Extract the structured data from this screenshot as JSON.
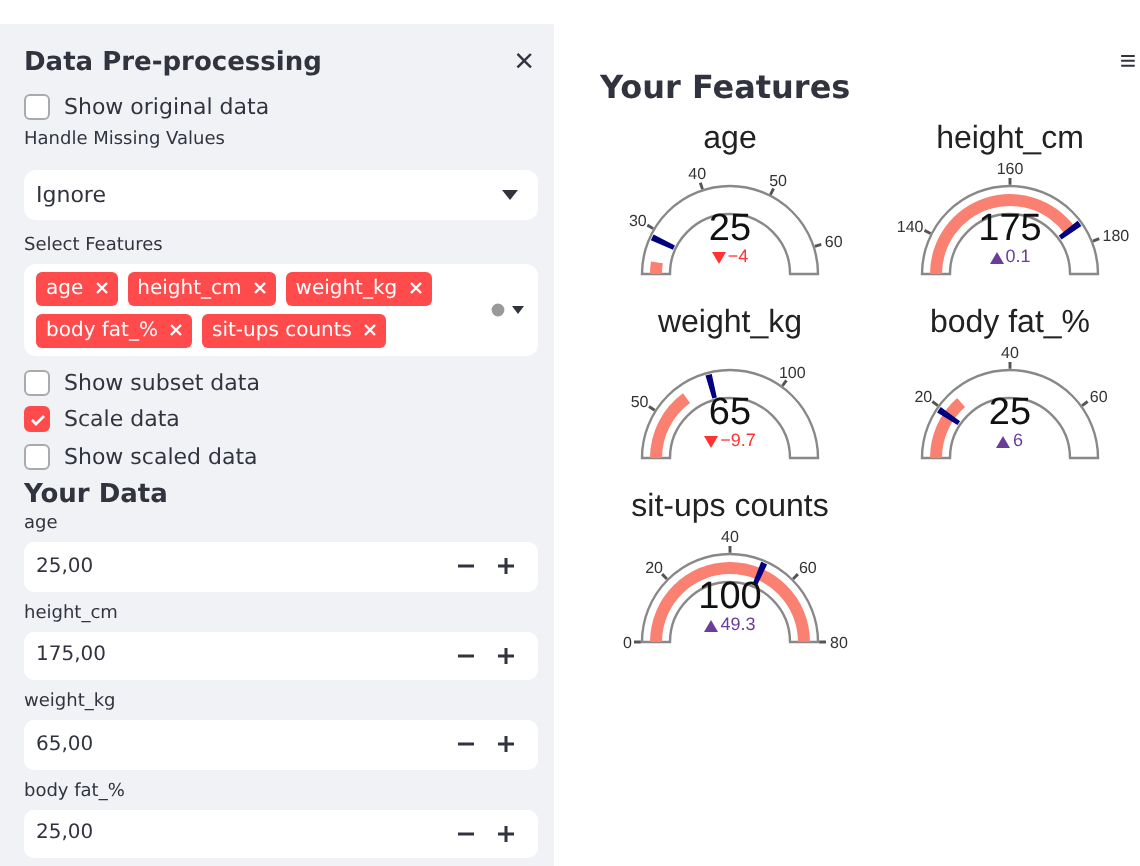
{
  "sidebar": {
    "title": "Data Pre-processing",
    "close": "×",
    "options_top": [
      {
        "label": "Show original data",
        "checked": false
      }
    ],
    "missing": {
      "label": "Handle Missing Values",
      "value": "Ignore"
    },
    "features": {
      "label": "Select Features",
      "tags": [
        "age",
        "height_cm",
        "weight_kg",
        "body fat_%",
        "sit-ups counts"
      ]
    },
    "options": [
      {
        "label": "Show subset data",
        "checked": false
      },
      {
        "label": "Scale data",
        "checked": true
      },
      {
        "label": "Show scaled data",
        "checked": false
      }
    ],
    "data_title": "Your Data",
    "inputs": [
      {
        "label": "age",
        "value": "25,00"
      },
      {
        "label": "height_cm",
        "value": "175,00"
      },
      {
        "label": "weight_kg",
        "value": "65,00"
      },
      {
        "label": "body fat_%",
        "value": "25,00"
      }
    ]
  },
  "main": {
    "menu": "≡",
    "title": "Your Features",
    "gauges": [
      {
        "title": "age",
        "value": "25",
        "delta": "−4",
        "increasing": false,
        "level": 0.05,
        "marker": {
          "level": 0.14
        },
        "ticks": [
          {
            "label": "30",
            "level": 0.17
          },
          {
            "label": "40",
            "level": 0.4
          },
          {
            "label": "50",
            "level": 0.65
          },
          {
            "label": "60",
            "level": 0.9
          }
        ]
      },
      {
        "title": "height_cm",
        "value": "175",
        "delta": "0.1",
        "increasing": true,
        "level": 0.8,
        "marker": {
          "level": 0.8
        },
        "ticks": [
          {
            "label": "140",
            "level": 0.15
          },
          {
            "label": "160",
            "level": 0.5
          },
          {
            "label": "180",
            "level": 0.88
          }
        ]
      },
      {
        "title": "weight_kg",
        "value": "65",
        "delta": "−9.7",
        "increasing": false,
        "level": 0.3,
        "marker": {
          "level": 0.42
        },
        "ticks": [
          {
            "label": "50",
            "level": 0.18
          },
          {
            "label": "100",
            "level": 0.7
          }
        ]
      },
      {
        "title": "body fat_%",
        "value": "25",
        "delta": "6",
        "increasing": true,
        "level": 0.27,
        "marker": {
          "level": 0.19
        },
        "ticks": [
          {
            "label": "20",
            "level": 0.2
          },
          {
            "label": "40",
            "level": 0.5
          },
          {
            "label": "60",
            "level": 0.8
          }
        ]
      },
      {
        "title": "sit-ups counts",
        "value": "100",
        "delta": "49.3",
        "increasing": true,
        "level": 1,
        "marker": {
          "level": 0.63
        },
        "ticks": [
          {
            "label": "0",
            "level": 0
          },
          {
            "label": "20",
            "level": 0.25
          },
          {
            "label": "40",
            "level": 0.5
          },
          {
            "label": "60",
            "level": 0.75
          },
          {
            "label": "80",
            "level": 1
          }
        ]
      }
    ]
  }
}
